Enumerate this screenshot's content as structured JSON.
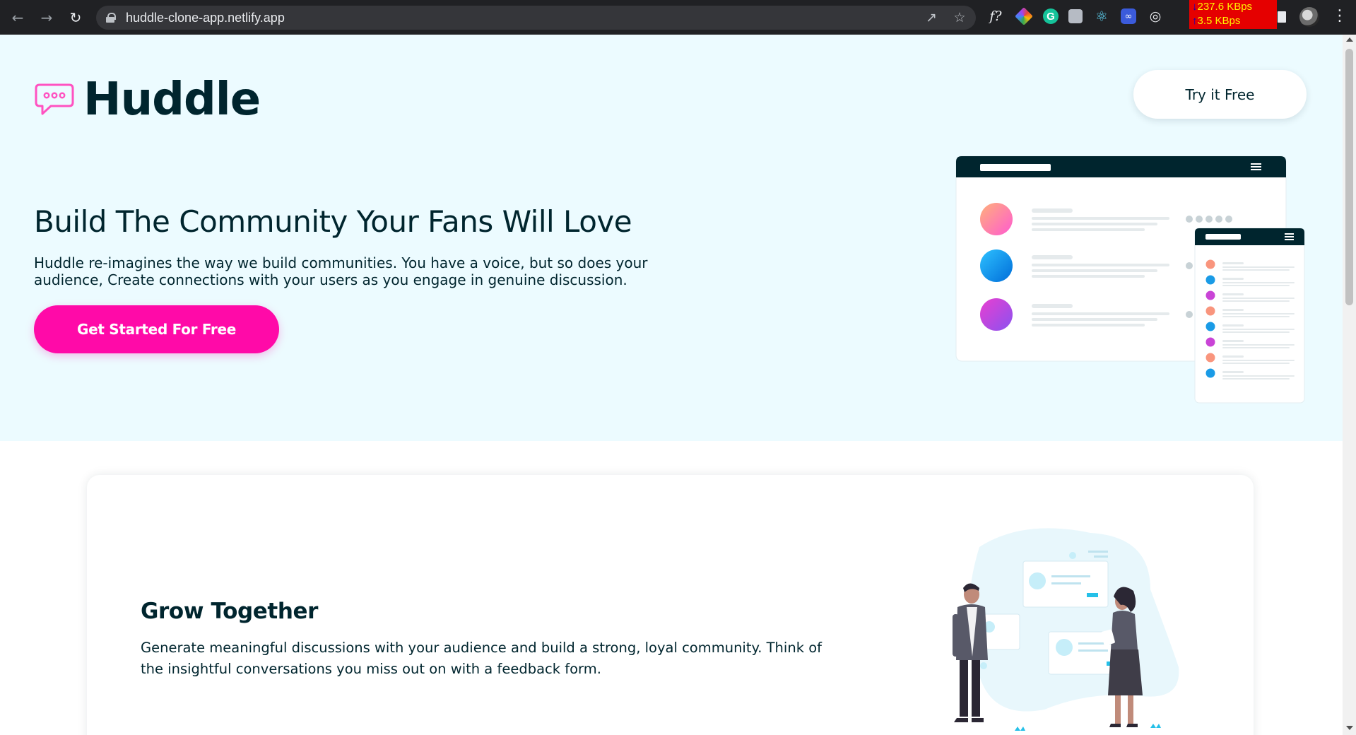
{
  "browser": {
    "url": "huddle-clone-app.netlify.app",
    "net_speed": {
      "down": "237.6 KBps",
      "up": "3.5 KBps"
    },
    "extensions": [
      "font-finder-icon",
      "color-picker-icon",
      "grammarly-icon",
      "extension-icon",
      "react-devtools-icon",
      "extension-icon",
      "target-icon"
    ]
  },
  "header": {
    "logo_text": "Huddle",
    "try_label": "Try it Free"
  },
  "hero": {
    "title": "Build The Community Your Fans Will Love",
    "description": "Huddle re-imagines the way we build communities. You have a voice, but so does your audience, Create connections with your users as you engage in genuine discussion.",
    "cta_label": "Get Started For Free"
  },
  "feature": {
    "title": "Grow Together",
    "description": "Generate meaningful discussions with your audience and build a strong, loyal community. Think of the insightful conversations you miss out on with a feedback form."
  },
  "colors": {
    "brand_dark": "#00252e",
    "brand_pink": "#ff0aa8",
    "hero_bg": "#ecfbff"
  }
}
